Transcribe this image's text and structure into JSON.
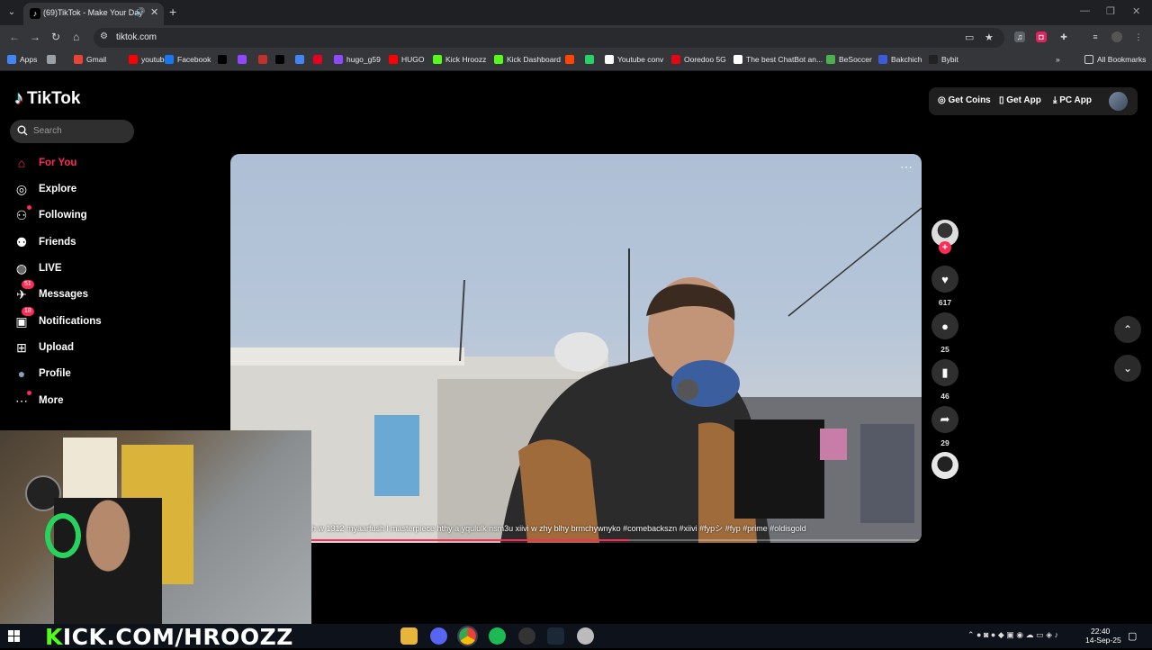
{
  "browser": {
    "tab": {
      "title": "(69)TikTok - Make Your Day"
    },
    "url": "tiktok.com",
    "bookmarks": [
      {
        "label": "Apps",
        "color": "#4285f4"
      },
      {
        "label": "",
        "color": "#9aa0a6"
      },
      {
        "label": "Gmail",
        "color": "#ea4335"
      },
      {
        "label": "youtube",
        "color": "#ff0000"
      },
      {
        "label": "Facebook",
        "color": "#1877f2"
      },
      {
        "label": "",
        "color": "#000000"
      },
      {
        "label": "",
        "color": "#9146ff"
      },
      {
        "label": "",
        "color": "#c4302b"
      },
      {
        "label": "",
        "color": "#000000"
      },
      {
        "label": "",
        "color": "#4285f4"
      },
      {
        "label": "",
        "color": "#e60023"
      },
      {
        "label": "hugo_g59",
        "color": "#9146ff"
      },
      {
        "label": "HUGO",
        "color": "#ff0000"
      },
      {
        "label": "Kick Hroozz",
        "color": "#53fc18"
      },
      {
        "label": "Kick Dashboard",
        "color": "#53fc18"
      },
      {
        "label": "",
        "color": "#ff4500"
      },
      {
        "label": "",
        "color": "#25d366"
      },
      {
        "label": "Youtube conv",
        "color": "#ffffff"
      },
      {
        "label": "Ooredoo 5G",
        "color": "#e30613"
      },
      {
        "label": "The best ChatBot an...",
        "color": "#ffffff"
      },
      {
        "label": "BeSoccer",
        "color": "#4caf50"
      },
      {
        "label": "Bakchich",
        "color": "#3b5bdb"
      },
      {
        "label": "Bybit",
        "color": "#222222"
      }
    ],
    "all_bookmarks": "All Bookmarks"
  },
  "tiktok": {
    "logo": "TikTok",
    "search_placeholder": "Search",
    "nav": [
      {
        "label": "For You",
        "icon": "home-icon",
        "active": true
      },
      {
        "label": "Explore",
        "icon": "compass-icon"
      },
      {
        "label": "Following",
        "icon": "following-icon"
      },
      {
        "label": "Friends",
        "icon": "friends-icon"
      },
      {
        "label": "LIVE",
        "icon": "live-icon"
      },
      {
        "label": "Messages",
        "icon": "messages-icon",
        "badge": "51"
      },
      {
        "label": "Notifications",
        "icon": "notifications-icon",
        "badge": "18"
      },
      {
        "label": "Upload",
        "icon": "upload-icon"
      },
      {
        "label": "Profile",
        "icon": "profile-avatar"
      },
      {
        "label": "More",
        "icon": "more-icon"
      }
    ],
    "top_actions": {
      "get_coins": "Get Coins",
      "get_app": "Get App",
      "pc_app": "PC App"
    },
    "video": {
      "caption": "h w 1312 myaarfush l masterpiece hthy a yqululk nsm3u xiivi w zhy blhy brmchywnyko #comebackszn  #xiivi  #fypシ  #fyp  #prime  #oldisgold",
      "progress": 0.52
    },
    "actions": {
      "likes": "617",
      "comments": "25",
      "saves": "46",
      "shares": "29"
    }
  },
  "stream_overlay": {
    "banner_k": "K",
    "banner_rest": "ICK.COM/HROOZZ"
  },
  "taskbar": {
    "time": "22:40",
    "date": "14-Sep-25"
  },
  "colors": {
    "accent": "#fe2c55",
    "kick_green": "#53fc18"
  }
}
